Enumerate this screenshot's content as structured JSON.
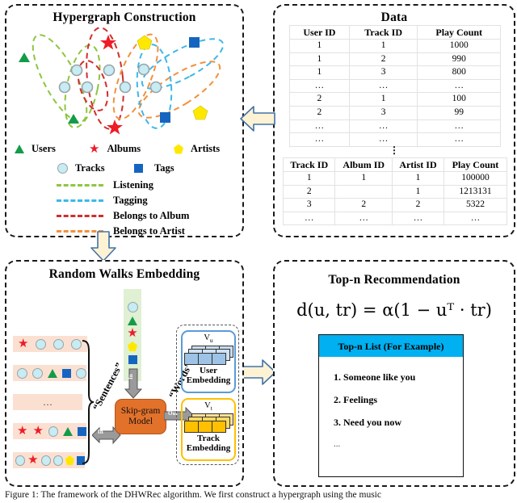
{
  "figure": {
    "caption": "Figure 1: The framework of the DHWRec algorithm.  We first construct a hypergraph using the music"
  },
  "panels": {
    "hypergraph": {
      "title": "Hypergraph Construction",
      "legend_nodes": [
        {
          "icon": "triangle-icon",
          "label": "Users",
          "color": "#149b49"
        },
        {
          "icon": "star-icon",
          "label": "Albums",
          "color": "#ee1c25"
        },
        {
          "icon": "pentagon-icon",
          "label": "Artists",
          "color": "#ffe800"
        },
        {
          "icon": "circle-icon",
          "label": "Tracks",
          "color": "#c7ecf3"
        },
        {
          "icon": "square-icon",
          "label": "Tags",
          "color": "#1565c0"
        }
      ],
      "legend_edges": [
        {
          "label": "Listening",
          "color": "#8dc63f"
        },
        {
          "label": "Tagging",
          "color": "#3cb8e8"
        },
        {
          "label": "Belongs to Album",
          "color": "#d12e2e"
        },
        {
          "label": "Belongs to Artist",
          "color": "#f2913d"
        }
      ]
    },
    "data": {
      "title": "Data",
      "table1": {
        "headers": [
          "User ID",
          "Track ID",
          "Play Count"
        ],
        "rows": [
          [
            "1",
            "1",
            "1000"
          ],
          [
            "1",
            "2",
            "990"
          ],
          [
            "1",
            "3",
            "800"
          ],
          [
            "…",
            "…",
            "…"
          ],
          [
            "2",
            "1",
            "100"
          ],
          [
            "2",
            "3",
            "99"
          ],
          [
            "…",
            "…",
            "…"
          ],
          [
            "…",
            "…",
            "…"
          ]
        ]
      },
      "separator": "⋮",
      "table2": {
        "headers": [
          "Track ID",
          "Album ID",
          "Artist ID",
          "Play Count"
        ],
        "rows": [
          [
            "1",
            "1",
            "1",
            "100000"
          ],
          [
            "2",
            "",
            "1",
            "1213131"
          ],
          [
            "3",
            "2",
            "2",
            "5322"
          ],
          [
            "…",
            "…",
            "…",
            "…"
          ]
        ]
      }
    },
    "walks": {
      "title": "Random Walks Embedding",
      "sentences_label": "“Sentences”",
      "words_label": "“Words”",
      "in_label": "In",
      "out_label": "Out",
      "model": {
        "line1": "Skip-gram",
        "line2": "Model"
      },
      "vocab_icons": [
        "circle-icon",
        "triangle-icon",
        "star-icon",
        "pentagon-icon",
        "square-icon"
      ],
      "walk_rows": [
        [
          "star",
          "circle",
          "circle",
          "circle"
        ],
        [
          "circle",
          "circle",
          "triangle",
          "square",
          "circle"
        ],
        [
          "dots"
        ],
        [
          "star",
          "star",
          "circle",
          "triangle",
          "square"
        ],
        [
          "circle",
          "star",
          "circle",
          "circle",
          "pentagon",
          "square"
        ]
      ],
      "dots_text": "…",
      "user_embedding": {
        "vector": "V",
        "sub": "u",
        "line1": "User",
        "line2": "Embedding",
        "color": "#5b9bd5"
      },
      "track_embedding": {
        "vector": "V",
        "sub": "t",
        "line1": "Track",
        "line2": "Embedding",
        "color": "#ffc000"
      }
    },
    "topn": {
      "title": "Top-n Recommendation",
      "formula": "d(u, tr) = α(1 − uᵀ · tr)",
      "list_header": "Top-n List (For Example)",
      "items": [
        "1. Someone like you",
        "2. Feelings",
        "3. Need you now"
      ],
      "more": "..."
    }
  },
  "arrows": {
    "data_to_hypergraph": "arrow-left",
    "hypergraph_to_walks": "arrow-down",
    "walks_to_topn": "arrow-right",
    "fill": "#fdf3d4",
    "stroke": "#4472a8"
  }
}
